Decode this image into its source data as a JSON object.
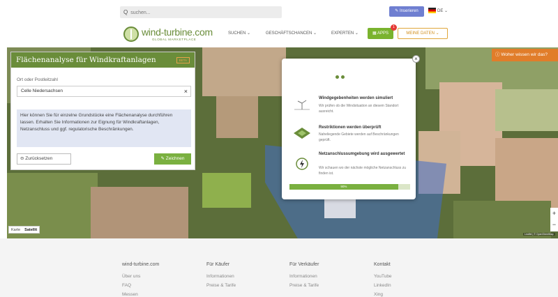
{
  "topbar": {
    "search_placeholder": "suchen...",
    "insert_label": "Inserieren",
    "lang_label": "DE"
  },
  "header": {
    "logo_title": "wind-turbine.com",
    "logo_subtitle": "GLOBAL MARKETPLACE",
    "nav": [
      "SUCHEN",
      "GESCHÄFTSCHANCEN",
      "EXPERTEN"
    ],
    "apps_label": "APPS",
    "apps_badge": "1",
    "mydata_label": "MEINE DATEN"
  },
  "panel": {
    "title": "Flächenanalyse für Windkraftanlagen",
    "badge": "BETA",
    "location_label": "Ort oder Postleitzahl",
    "location_value": "Celle Niedersachsen",
    "info_text": "Hier können Sie für einzelne Grundstücke eine Flächenanalyse durchführen lassen. Erhalten Sie Informationen zur Eignung für Windkraftanlagen, Netzanschluss und ggf. regulatorische Beschränkungen.",
    "reset_label": "Zurücksetzen",
    "draw_label": "Zeichnen"
  },
  "map": {
    "woher_label": "Woher wissen wir das?",
    "type_options": [
      "Karte",
      "Satellit"
    ],
    "selected_type": "Satellit",
    "attribution": "Leaflet | © OpenStreetMap"
  },
  "dialog": {
    "steps": [
      {
        "title": "Windgegebenheiten werden simuliert",
        "text": "Wir prüfen ob die Windsituation an diesem Standort ausreicht.",
        "icon": "wind-turbine-icon"
      },
      {
        "title": "Restriktionen werden überprüft",
        "text": "Naheliegende Gebiete werden auf Beschränkungen geprüft.",
        "icon": "area-map-icon"
      },
      {
        "title": "Netzanschlussumgebung wird ausgewertet",
        "text": "Wir schauen wo der nächste mögliche Netzanschluss zu finden ist.",
        "icon": "power-plug-icon"
      }
    ],
    "progress_percent": 90,
    "progress_label": "90%"
  },
  "footer": {
    "columns": [
      {
        "title": "wind-turbine.com",
        "links": [
          "Über uns",
          "FAQ",
          "Messen"
        ]
      },
      {
        "title": "Für Käufer",
        "links": [
          "Informationen",
          "Preise & Tarife"
        ]
      },
      {
        "title": "Für Verkäufer",
        "links": [
          "Informationen",
          "Preise & Tarife"
        ]
      },
      {
        "title": "Kontakt",
        "links": [
          "YouTube",
          "LinkedIn",
          "Xing"
        ]
      }
    ]
  },
  "colors": {
    "brand_green": "#6a8d3a",
    "accent_orange": "#e17d2a",
    "button_blue": "#6f7fd1"
  }
}
